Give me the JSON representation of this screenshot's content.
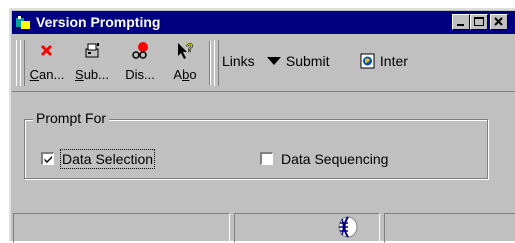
{
  "window": {
    "title": "Version Prompting",
    "icon": "app-icon"
  },
  "title_buttons": [
    "minimize-icon",
    "maximize-icon",
    "close-icon"
  ],
  "toolbar": {
    "buttons": [
      {
        "label_prefix": "C",
        "label_rest": "an...",
        "icon": "cancel-icon",
        "icon_color": "#ff0000"
      },
      {
        "label_prefix": "S",
        "label_rest": "ub...",
        "icon": "submit-icon"
      },
      {
        "label_prefix": "",
        "label_rest": "Dis...",
        "icon": "display-icon"
      },
      {
        "label_prefix": "A",
        "label_mid": "b",
        "label_rest": "o",
        "icon": "about-icon"
      }
    ],
    "links": [
      {
        "label": "Links",
        "icon": ""
      },
      {
        "label": "Submit",
        "icon": "triangle-down-icon"
      },
      {
        "label": "Inter",
        "icon": "internet-icon"
      }
    ]
  },
  "prompt_for": {
    "label": "Prompt For",
    "options": [
      {
        "label": "Data Selection",
        "checked": true,
        "focused": true
      },
      {
        "label": "Data Sequencing",
        "checked": false,
        "focused": false
      }
    ]
  },
  "status": {
    "globe_icon": "globe-icon"
  }
}
